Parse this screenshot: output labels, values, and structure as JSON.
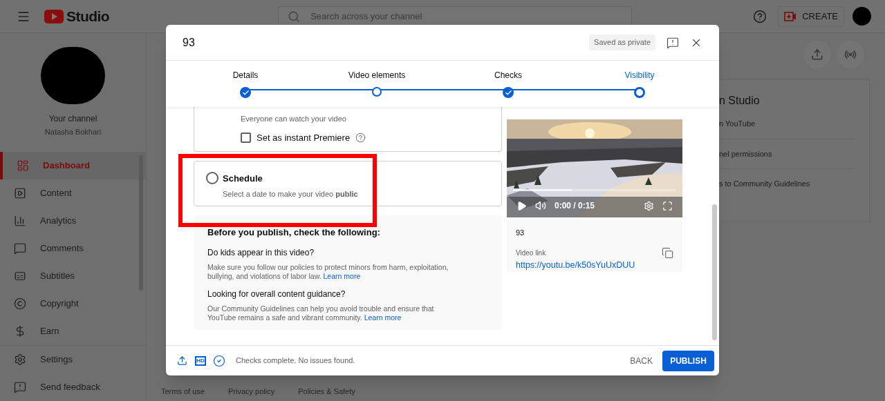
{
  "topbar": {
    "logo": "Studio",
    "search": {
      "placeholder": "Search across your channel"
    },
    "create": "CREATE"
  },
  "sidebar": {
    "channel_title": "Your channel",
    "channel_name": "Natasha Bokhari",
    "items": [
      {
        "label": "Dashboard",
        "kind": "dashboard",
        "selected": true
      },
      {
        "label": "Content",
        "kind": "content",
        "selected": false
      },
      {
        "label": "Analytics",
        "kind": "analytics",
        "selected": false
      },
      {
        "label": "Comments",
        "kind": "comments",
        "selected": false
      },
      {
        "label": "Subtitles",
        "kind": "subtitles",
        "selected": false
      },
      {
        "label": "Copyright",
        "kind": "copyright",
        "selected": false
      },
      {
        "label": "Earn",
        "kind": "earn",
        "selected": false
      }
    ],
    "bottom_items": [
      {
        "label": "Settings",
        "kind": "settings"
      },
      {
        "label": "Send feedback",
        "kind": "feedback"
      }
    ]
  },
  "background_card": {
    "title": "n Studio",
    "items": [
      "n YouTube",
      "nel permissions",
      "s to Community Guidelines"
    ]
  },
  "footer_links": [
    "Terms of use",
    "Privacy policy",
    "Policies & Safety"
  ],
  "dialog": {
    "title": "93",
    "save_status": "Saved as private",
    "steps": [
      {
        "label": "Details",
        "done": true,
        "selected": false
      },
      {
        "label": "Video elements",
        "done": false,
        "selected": false
      },
      {
        "label": "Checks",
        "done": true,
        "selected": false
      },
      {
        "label": "Visibility",
        "done": false,
        "selected": true
      }
    ],
    "public_option": {
      "description": "Everyone can watch your video",
      "premiere": {
        "label": "Set as instant Premiere",
        "checked": false
      }
    },
    "schedule_option": {
      "label": "Schedule",
      "description": "Select a date to make your video **public**",
      "selected": false
    },
    "checklist": {
      "title": "Before you publish, check the following:",
      "sections": [
        {
          "heading": "Do kids appear in this video?",
          "text": "Make sure you follow our policies to protect minors from harm, exploitation, bullying, and violations of labor law.",
          "link": "Learn more"
        },
        {
          "heading": "Looking for overall content guidance?",
          "text": "Our Community Guidelines can help you avoid trouble and ensure that YouTube remains a safe and vibrant community.",
          "link": "Learn more"
        }
      ]
    },
    "preview": {
      "time": "0:00 / 0:15",
      "video_title": "93",
      "link_label": "Video link",
      "link": "https://youtu.be/k50sYuUxDUU"
    },
    "quality_badge": "HD",
    "status": "Checks complete. No issues found.",
    "back": "BACK",
    "publish": "PUBLISH"
  }
}
